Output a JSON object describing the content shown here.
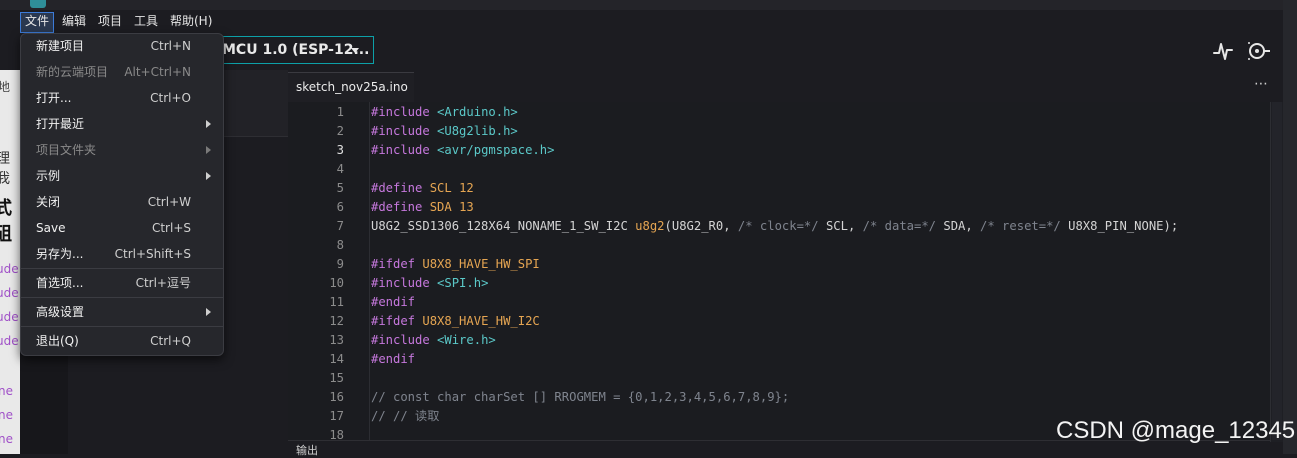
{
  "menubar": {
    "file": "文件",
    "edit": "编辑",
    "sketch": "项目",
    "tools": "工具",
    "help": "帮助(H)"
  },
  "toolbar": {
    "board": "MCU 1.0 (ESP-12..."
  },
  "tab": {
    "filename": "sketch_nov25a.ino",
    "more": "⋯"
  },
  "left_fragments": {
    "f1": "地",
    "f2": "理我",
    "f3": "式砠",
    "f4": "ude",
    "f5": "ude",
    "f6": "ude",
    "f7": "ude",
    "f8": "ne",
    "f9": "ne",
    "f10": "ne"
  },
  "file_menu": {
    "new": "新建项目",
    "new_sc": "Ctrl+N",
    "new_cloud": "新的云端项目",
    "new_cloud_sc": "Alt+Ctrl+N",
    "open": "打开...",
    "open_sc": "Ctrl+O",
    "open_recent": "打开最近",
    "sketchbook": "项目文件夹",
    "examples": "示例",
    "close": "关闭",
    "close_sc": "Ctrl+W",
    "save": "Save",
    "save_sc": "Ctrl+S",
    "save_as": "另存为...",
    "save_as_sc": "Ctrl+Shift+S",
    "preferences": "首选项...",
    "preferences_sc": "Ctrl+逗号",
    "advanced": "高级设置",
    "quit": "退出(Q)",
    "quit_sc": "Ctrl+Q"
  },
  "editor": {
    "line_numbers": [
      "1",
      "2",
      "3",
      "4",
      "5",
      "6",
      "7",
      "8",
      "9",
      "10",
      "11",
      "12",
      "13",
      "14",
      "15",
      "16",
      "17",
      "18"
    ],
    "l1_kw": "#include",
    "l1_str": "<Arduino.h>",
    "l2_kw": "#include",
    "l2_str": "<U8g2lib.h>",
    "l3_kw": "#include",
    "l3_str": "<avr/pgmspace.h>",
    "l5_kw": "#define",
    "l5_name": "SCL",
    "l5_val": "12",
    "l6_kw": "#define",
    "l6_name": "SDA",
    "l6_val": "13",
    "l7_type": "U8G2_SSD1306_128X64_NONAME_1_SW_I2C",
    "l7_var": "u8g2",
    "l7_a": "(U8G2_R0, ",
    "l7_c1": "/* clock=*/",
    "l7_b": " SCL, ",
    "l7_c2": "/* data=*/",
    "l7_d": " SDA, ",
    "l7_c3": "/* reset=*/",
    "l7_e": " U8X8_PIN_NONE);",
    "l9_kw": "#ifdef",
    "l9_name": "U8X8_HAVE_HW_SPI",
    "l10_kw": "#include",
    "l10_str": "<SPI.h>",
    "l11_kw": "#endif",
    "l12_kw": "#ifdef",
    "l12_name": "U8X8_HAVE_HW_I2C",
    "l13_kw": "#include",
    "l13_str": "<Wire.h>",
    "l14_kw": "#endif",
    "l16": "// const char charSet [] RROGMEM = {0,1,2,3,4,5,6,7,8,9};",
    "l17": "// // 读取"
  },
  "bottom": {
    "output": "输出"
  },
  "watermark": "CSDN @mage_12345",
  "colors": {
    "accent": "#0da0a8",
    "keyword": "#c678dd",
    "string": "#5bc8c8",
    "constant": "#e5a552",
    "comment": "#7f848e"
  }
}
